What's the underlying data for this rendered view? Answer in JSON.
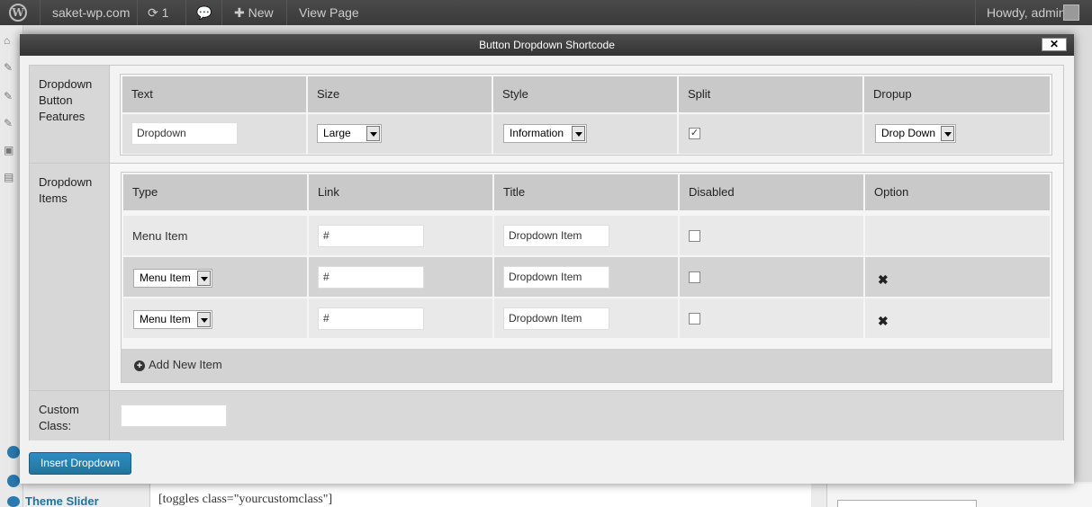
{
  "adminbar": {
    "site_name": "saket-wp.com",
    "updates_count": "1",
    "new_label": "New",
    "view_page_label": "View Page",
    "greeting": "Howdy, admin"
  },
  "background": {
    "shortcode_text": "[toggles class=\"yourcustomclass\"]",
    "theme_slider_label": "Theme Slider"
  },
  "modal": {
    "title": "Button Dropdown Shortcode",
    "close_label": "✕"
  },
  "features": {
    "label": "Dropdown Button Features",
    "headers": [
      "Text",
      "Size",
      "Style",
      "Split",
      "Dropup"
    ],
    "text_value": "Dropdown",
    "size_value": "Large",
    "style_value": "Information",
    "split_checked": true,
    "dropup_value": "Drop Down"
  },
  "items": {
    "label": "Dropdown Items",
    "headers": [
      "Type",
      "Link",
      "Title",
      "Disabled",
      "Option"
    ],
    "rows": [
      {
        "type": "Menu Item",
        "link": "#",
        "title": "Dropdown Item",
        "disabled": false,
        "removable": false
      },
      {
        "type": "Menu Item",
        "link": "#",
        "title": "Dropdown Item",
        "disabled": false,
        "removable": true
      },
      {
        "type": "Menu Item",
        "link": "#",
        "title": "Dropdown Item",
        "disabled": false,
        "removable": true
      }
    ],
    "add_label": "Add New Item"
  },
  "custom_class": {
    "label": "Custom Class:",
    "value": ""
  },
  "insert_button_label": "Insert Dropdown"
}
